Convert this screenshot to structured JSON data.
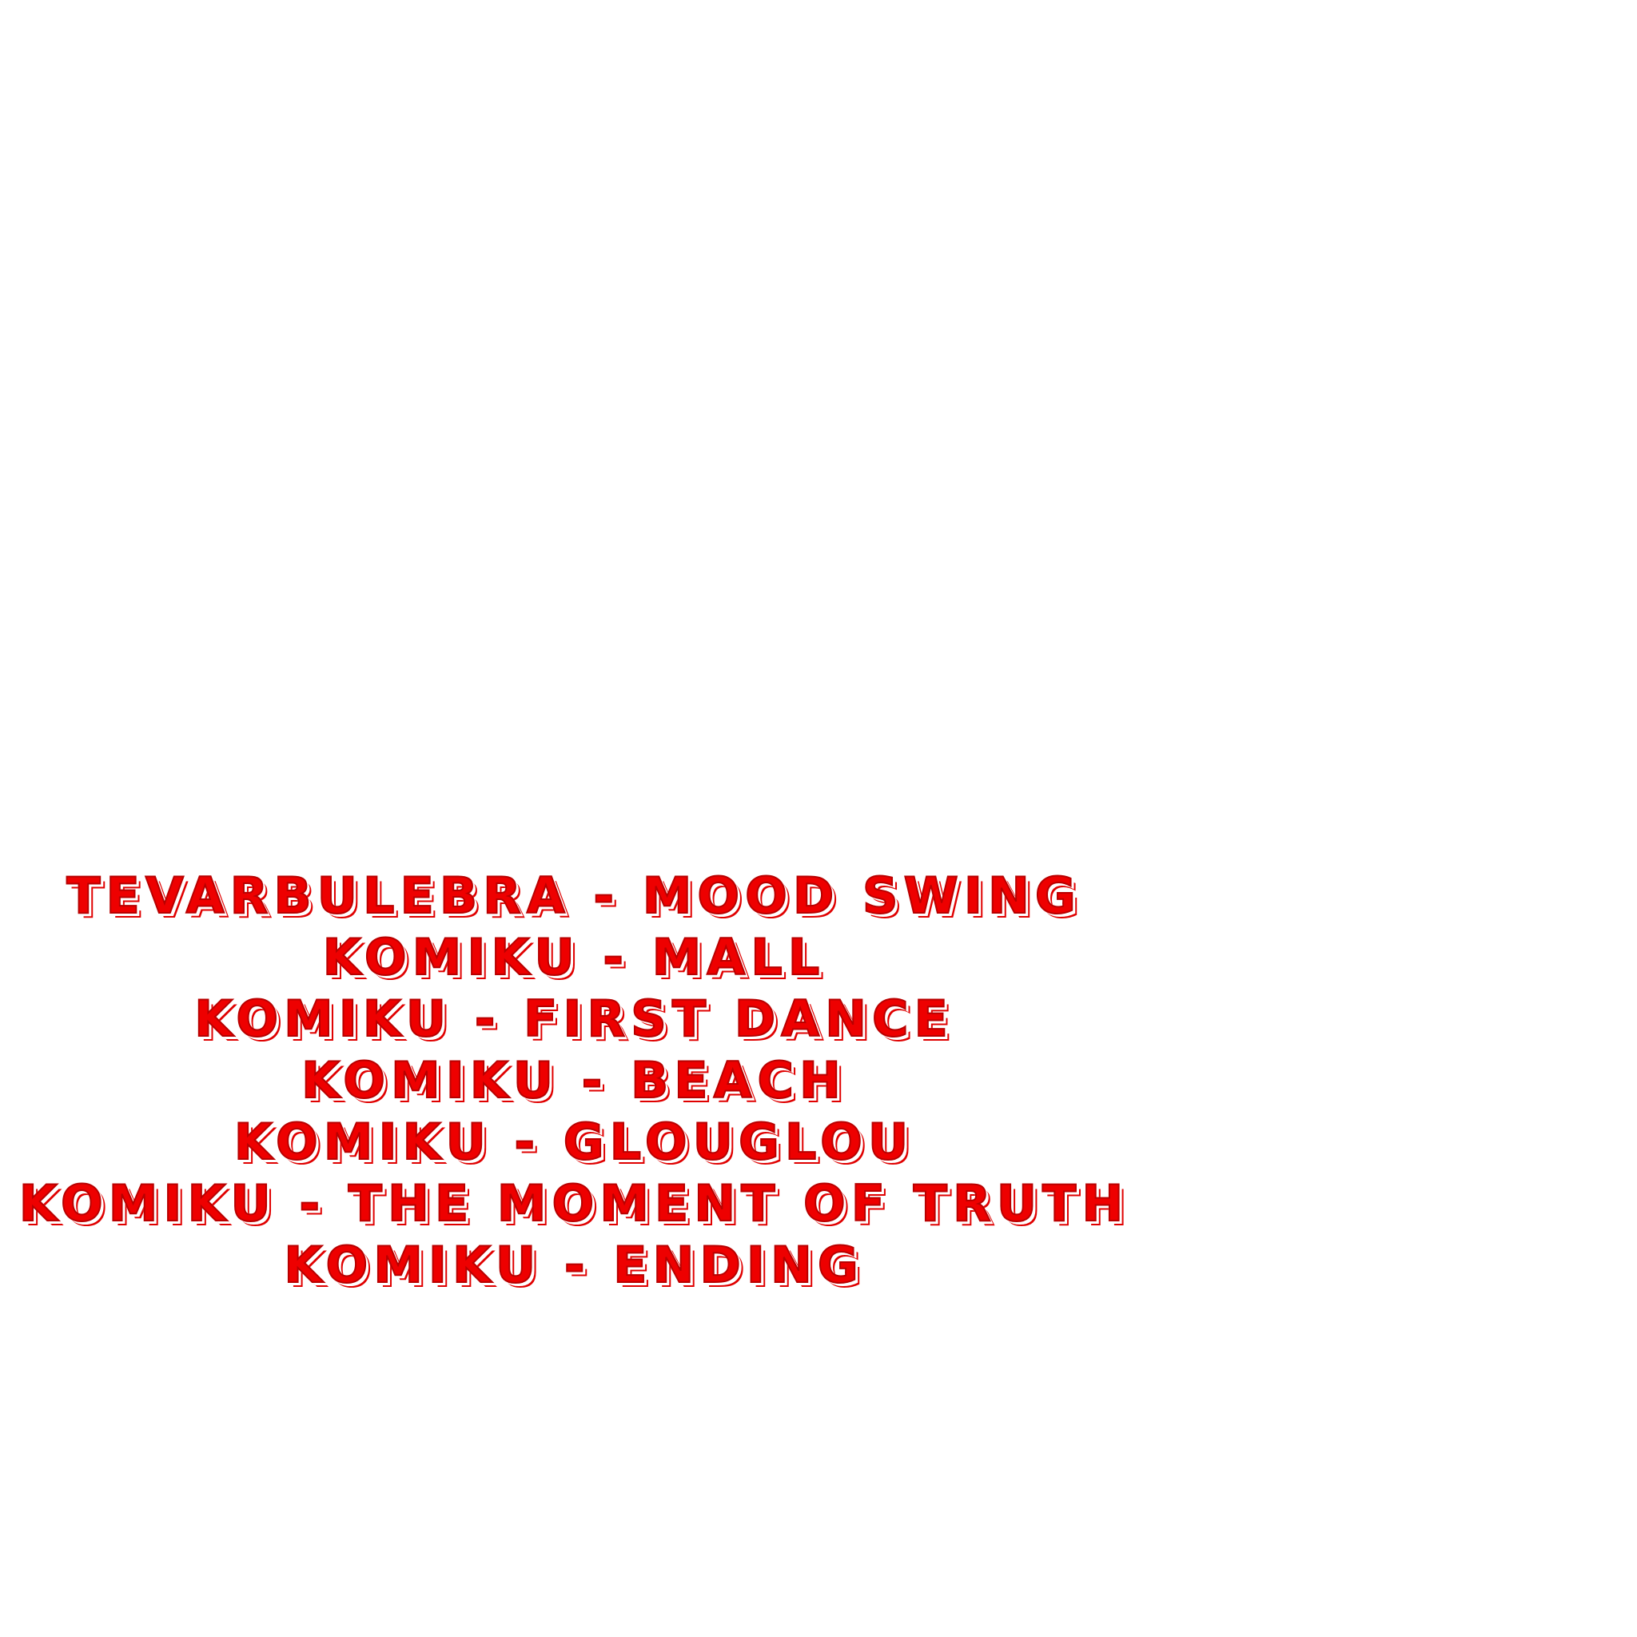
{
  "colors": {
    "background": "#ffffff",
    "text_fill": "#ee0000",
    "text_outline": "#b80000"
  },
  "credits": [
    "TEVARBULEBRA - MOOD SWING",
    "KOMIKU - MALL",
    "KOMIKU - FIRST DANCE",
    "KOMIKU - BEACH",
    "KOMIKU - GLOUGLOU",
    "KOMIKU - THE MOMENT OF TRUTH",
    "KOMIKU - ENDING"
  ]
}
